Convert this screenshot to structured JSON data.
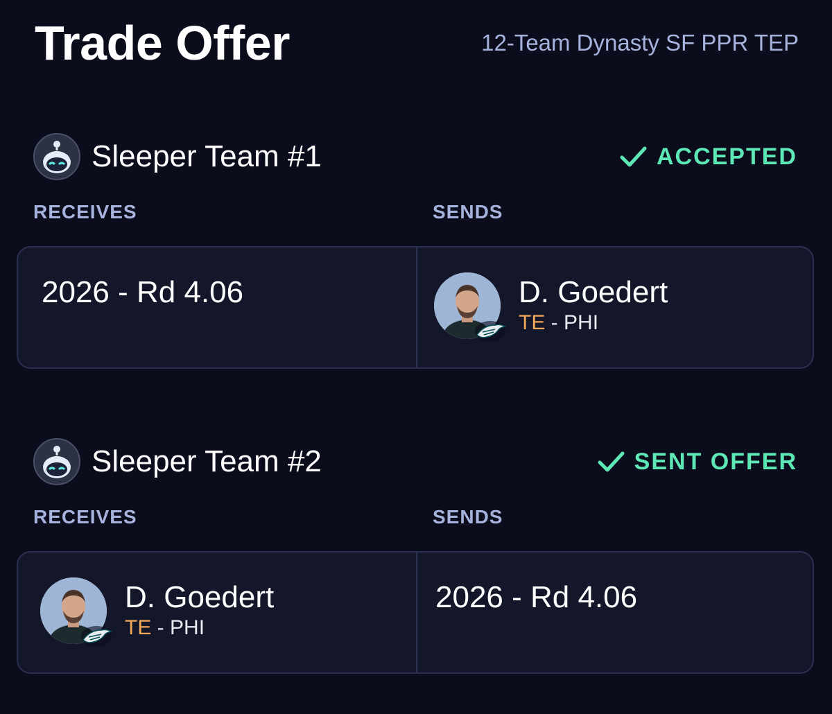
{
  "header": {
    "title": "Trade Offer",
    "league": "12-Team Dynasty SF PPR TEP"
  },
  "colors": {
    "background": "#0b0d1d",
    "panel": "#141729",
    "accent_green": "#5ee8b6",
    "label": "#a6b3dc",
    "position_te": "#f4a85a"
  },
  "teams": [
    {
      "name": "Sleeper Team #1",
      "status": "ACCEPTED",
      "status_icon": "check-icon",
      "receives_label": "RECEIVES",
      "sends_label": "SENDS",
      "receives": {
        "pick": "2026 - Rd 4.06"
      },
      "sends": {
        "player_name": "D. Goedert",
        "position": "TE",
        "separator": " - ",
        "team": "PHI",
        "team_logo": "eagles-logo"
      }
    },
    {
      "name": "Sleeper Team #2",
      "status": "SENT OFFER",
      "status_icon": "check-icon",
      "receives_label": "RECEIVES",
      "sends_label": "SENDS",
      "receives": {
        "player_name": "D. Goedert",
        "position": "TE",
        "separator": " - ",
        "team": "PHI",
        "team_logo": "eagles-logo"
      },
      "sends": {
        "pick": "2026 - Rd 4.06"
      }
    }
  ]
}
